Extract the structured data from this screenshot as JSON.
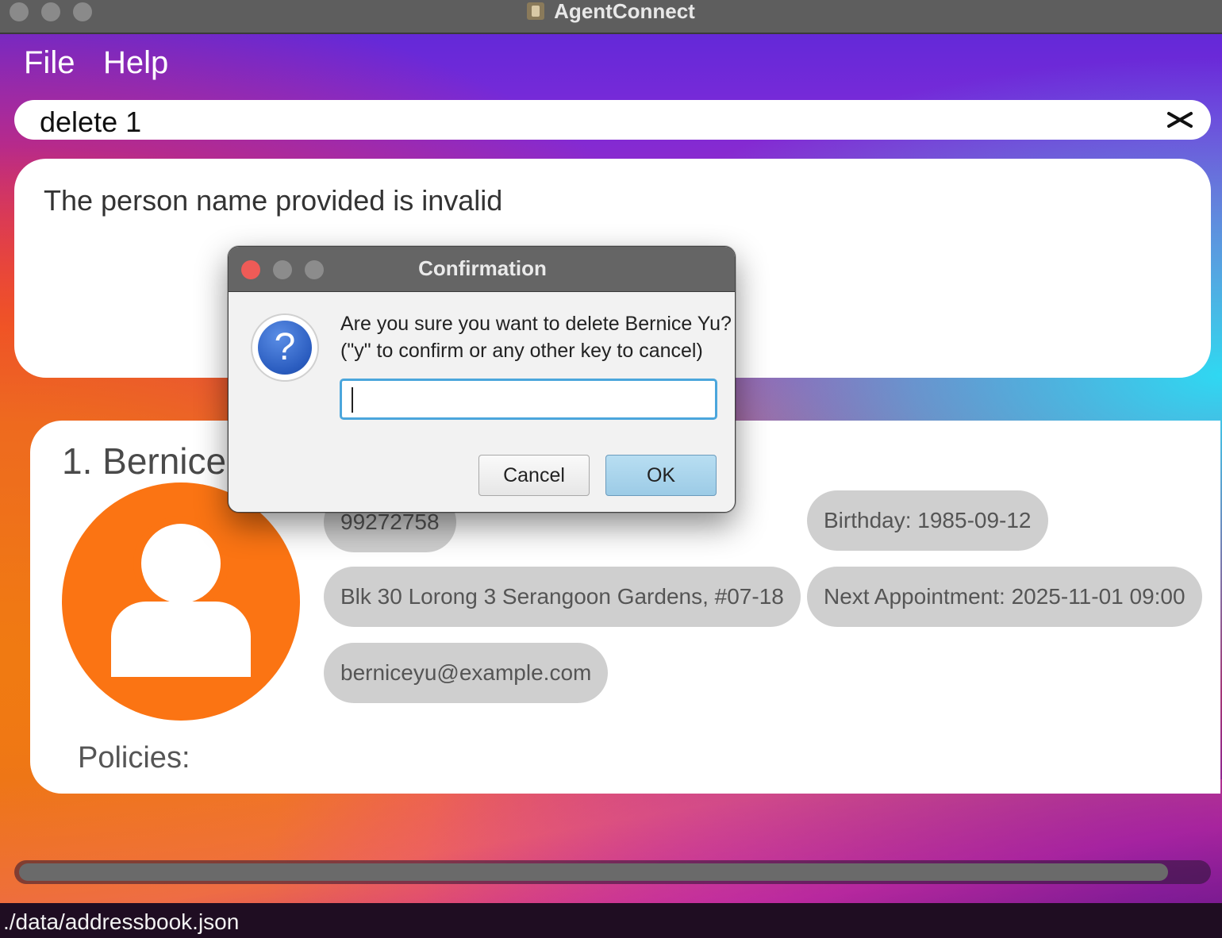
{
  "window": {
    "title": "AgentConnect"
  },
  "menu": {
    "file": "File",
    "help": "Help"
  },
  "command": {
    "value": "delete 1"
  },
  "result": {
    "message": "The person name provided is invalid"
  },
  "person": {
    "name": "1. Bernice Y",
    "phone": "99272758",
    "address": "Blk 30 Lorong 3 Serangoon Gardens, #07-18",
    "email": "berniceyu@example.com",
    "birthday": "Birthday: 1985-09-12",
    "appointment": "Next Appointment: 2025-11-01 09:00",
    "policies_label": "Policies:"
  },
  "dialog": {
    "title": "Confirmation",
    "line1": "Are you sure you want to delete Bernice Yu?",
    "line2": "(\"y\" to confirm or any other key to cancel)",
    "input_value": "",
    "cancel_label": "Cancel",
    "ok_label": "OK",
    "icon": "question-icon"
  },
  "status": {
    "path": "./data/addressbook.json"
  },
  "colors": {
    "avatar": "#fb7413",
    "pill": "#cfcfcf",
    "ok_button": "#a8d4ec",
    "input_focus": "#4ba6dc",
    "close_dot": "#ee5b57"
  }
}
